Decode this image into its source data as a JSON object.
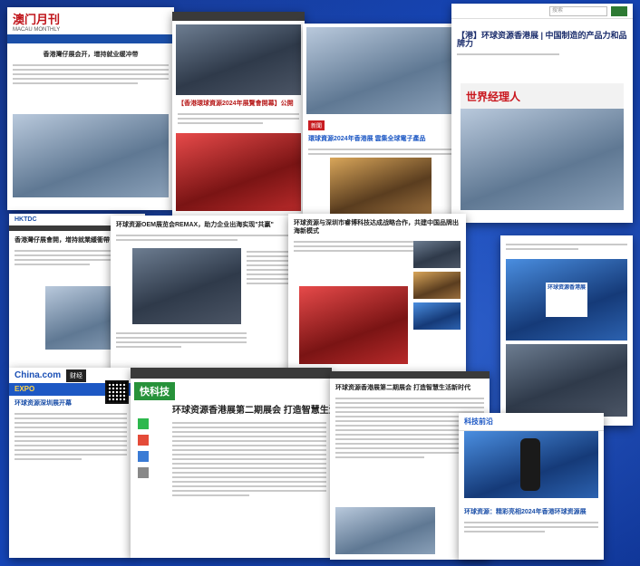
{
  "cards": {
    "c1": {
      "logo": "澳门月刊",
      "logo_sub": "MACAU MONTHLY",
      "headline": "香港灣仔展会开，增持就业缓冲带"
    },
    "c2": {
      "headline": "【香港環球資源2024年展覽會開幕】公開"
    },
    "c3": {
      "headline": "環球資源2024年香港展 雲集全球電子產品",
      "tag": "新聞"
    },
    "c4": {
      "headline": "【港】环球资源香港展 | 中国制造的产品力和品牌力",
      "badge": "世界经理人",
      "top_search": "搜索"
    },
    "c5": {
      "logo": "HKTDC",
      "headline": "香港灣仔展會開，增持就業緩衝帶"
    },
    "c6": {
      "headline": "环球资源OEM展览会REMAX，助力企业出海实现\"共赢\""
    },
    "c7": {
      "headline": "环球资源与深圳市睿博科技达成战略合作，共建中国品牌出海新模式"
    },
    "c8": {
      "headline": "环球资源香港展"
    },
    "c9": {
      "logo": "China.com",
      "channel": "财经",
      "banner": "EXPO",
      "headline": "环球资源深圳展开幕"
    },
    "c10": {
      "logo": "快科技",
      "headline": "环球资源香港展第二期展会 打造智慧生活新时代"
    },
    "c11": {
      "headline": "环球资源香港展第二期展会 打造智慧生活新时代"
    },
    "c12": {
      "headline": "科技前沿",
      "caption": "环球资源：精彩亮相2024年香港环球资源展"
    }
  }
}
